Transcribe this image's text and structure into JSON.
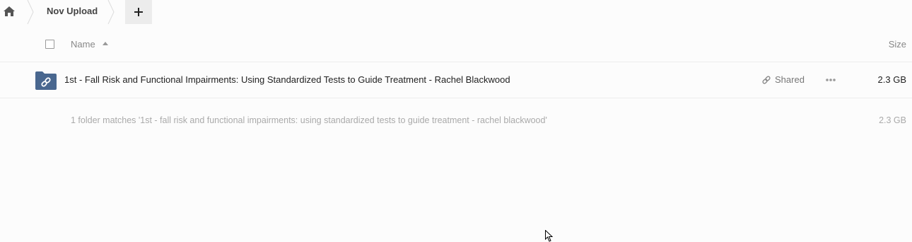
{
  "breadcrumb": {
    "home_icon": "home-icon",
    "current": "Nov Upload",
    "add_icon": "plus-icon"
  },
  "header": {
    "name_label": "Name",
    "size_label": "Size",
    "sort_icon": "sort-ascending-icon"
  },
  "files": [
    {
      "icon": "shared-link-folder-icon",
      "name": "1st - Fall Risk and Functional Impairments: Using Standardized Tests to Guide Treatment - Rachel Blackwood",
      "share_label": "Shared",
      "share_icon": "link-icon",
      "menu_icon": "more-options-icon",
      "size": "2.3 GB"
    }
  ],
  "summary": {
    "text": "1 folder matches '1st - fall risk and functional impairments: using standardized tests to guide treatment - rachel blackwood'",
    "size": "2.3 GB"
  },
  "colors": {
    "folder": "#49678f",
    "background": "#fcfcfc",
    "add_button_bg": "#ececec"
  }
}
